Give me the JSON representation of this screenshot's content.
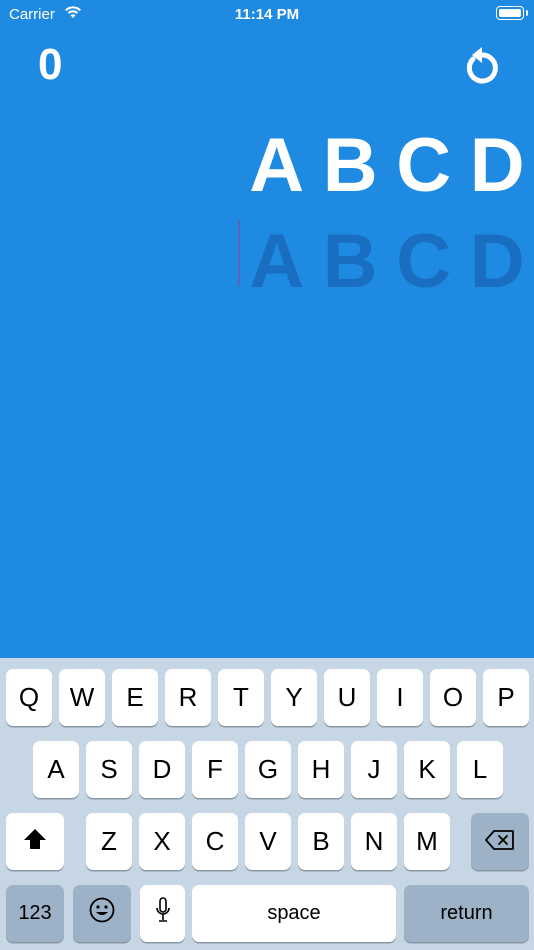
{
  "status_bar": {
    "carrier": "Carrier",
    "time": "11:14 PM"
  },
  "game": {
    "score": "0",
    "target_letters": [
      "A",
      "B",
      "C",
      "D"
    ],
    "typed_letters": [
      "A",
      "B",
      "C",
      "D"
    ]
  },
  "keyboard": {
    "row1": [
      "Q",
      "W",
      "E",
      "R",
      "T",
      "Y",
      "U",
      "I",
      "O",
      "P"
    ],
    "row2": [
      "A",
      "S",
      "D",
      "F",
      "G",
      "H",
      "J",
      "K",
      "L"
    ],
    "row3": [
      "Z",
      "X",
      "C",
      "V",
      "B",
      "N",
      "M"
    ],
    "numbers_label": "123",
    "space_label": "space",
    "return_label": "return"
  },
  "colors": {
    "background": "#1f8ae2",
    "typed_letters": "#1a6ec2",
    "keyboard": "#c7d6e5"
  }
}
